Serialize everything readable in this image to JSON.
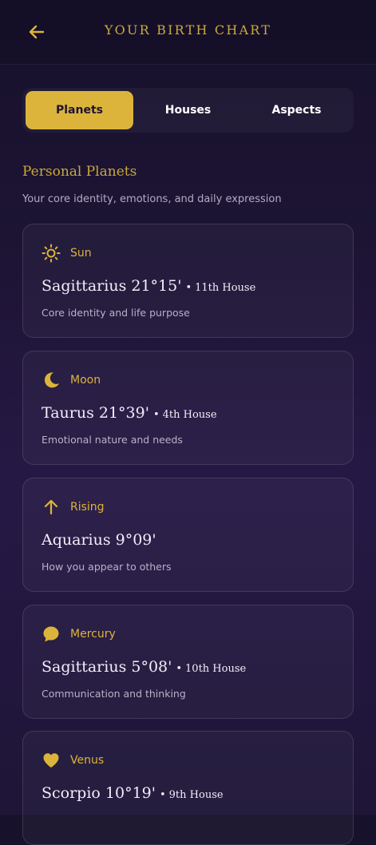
{
  "header": {
    "title": "YOUR BIRTH CHART",
    "back_icon": "arrow-left-icon"
  },
  "tabs": [
    {
      "label": "Planets",
      "active": true
    },
    {
      "label": "Houses",
      "active": false
    },
    {
      "label": "Aspects",
      "active": false
    }
  ],
  "section": {
    "title": "Personal Planets",
    "subtitle": "Your core identity, emotions, and daily expression"
  },
  "placements": [
    {
      "name": "Sun",
      "icon": "sun-icon",
      "position": "Sagittarius 21°15'",
      "house": "11th House",
      "description": "Core identity and life purpose"
    },
    {
      "name": "Moon",
      "icon": "moon-icon",
      "position": "Taurus 21°39'",
      "house": "4th House",
      "description": "Emotional nature and needs"
    },
    {
      "name": "Rising",
      "icon": "arrow-up-icon",
      "position": "Aquarius 9°09'",
      "house": "",
      "description": "How you appear to others"
    },
    {
      "name": "Mercury",
      "icon": "speech-bubble-icon",
      "position": "Sagittarius 5°08'",
      "house": "10th House",
      "description": "Communication and thinking"
    },
    {
      "name": "Venus",
      "icon": "heart-icon",
      "position": "Scorpio 10°19'",
      "house": "9th House",
      "description": ""
    }
  ],
  "colors": {
    "accent": "#dcb43b",
    "background": "#1d1434"
  }
}
